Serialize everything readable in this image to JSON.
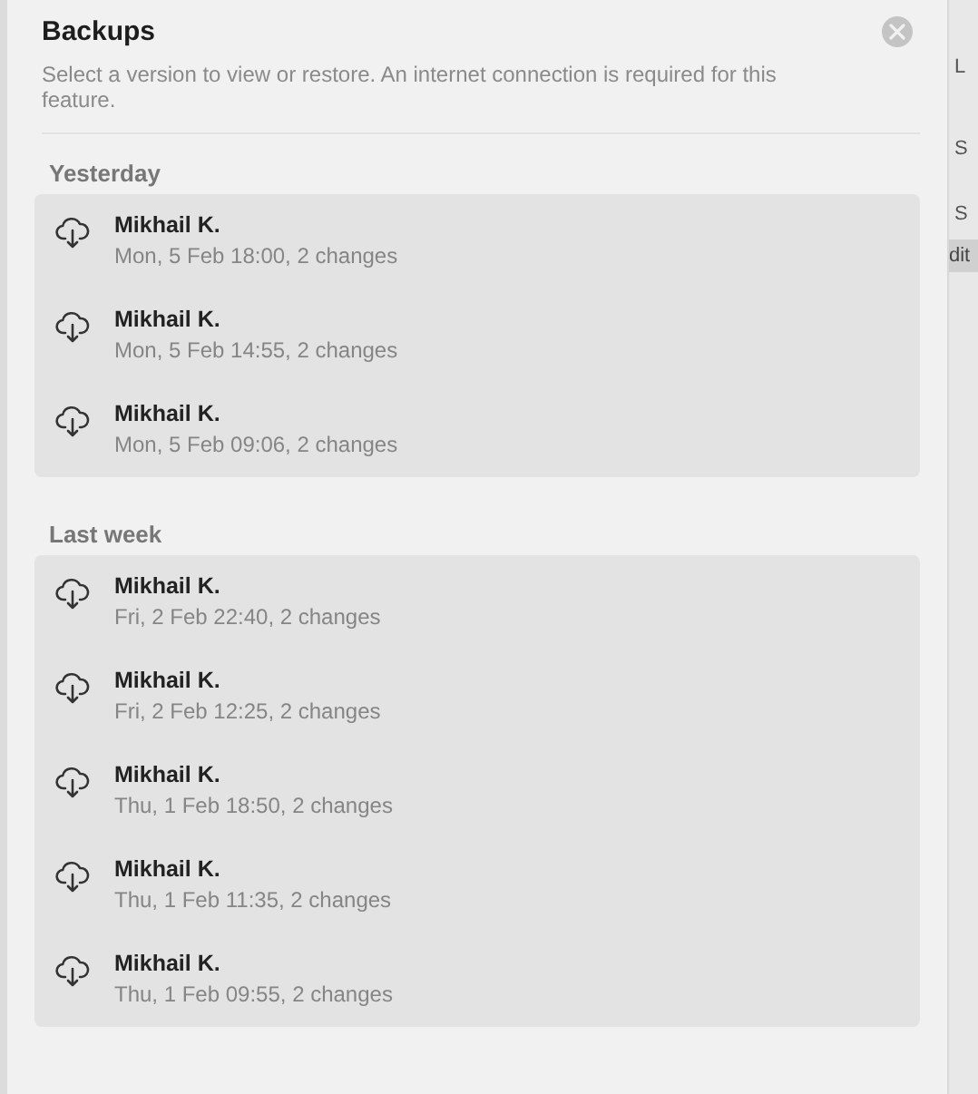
{
  "sheet": {
    "title": "Backups",
    "description": "Select a version to view or restore. An internet connection is required for this feature.",
    "groups": [
      {
        "label": "Yesterday",
        "items": [
          {
            "author": "Mikhail K.",
            "detail": "Mon, 5 Feb 18:00, 2 changes"
          },
          {
            "author": "Mikhail K.",
            "detail": "Mon, 5 Feb 14:55, 2 changes"
          },
          {
            "author": "Mikhail K.",
            "detail": "Mon, 5 Feb 09:06, 2 changes"
          }
        ]
      },
      {
        "label": "Last week",
        "items": [
          {
            "author": "Mikhail K.",
            "detail": "Fri, 2 Feb 22:40, 2 changes"
          },
          {
            "author": "Mikhail K.",
            "detail": "Fri, 2 Feb 12:25, 2 changes"
          },
          {
            "author": "Mikhail K.",
            "detail": "Thu, 1 Feb 18:50, 2 changes"
          },
          {
            "author": "Mikhail K.",
            "detail": "Thu, 1 Feb 11:35, 2 changes"
          },
          {
            "author": "Mikhail K.",
            "detail": "Thu, 1 Feb 09:55, 2 changes"
          }
        ]
      }
    ]
  },
  "background": {
    "items": [
      "L",
      "S",
      "S"
    ],
    "button": "dit"
  }
}
